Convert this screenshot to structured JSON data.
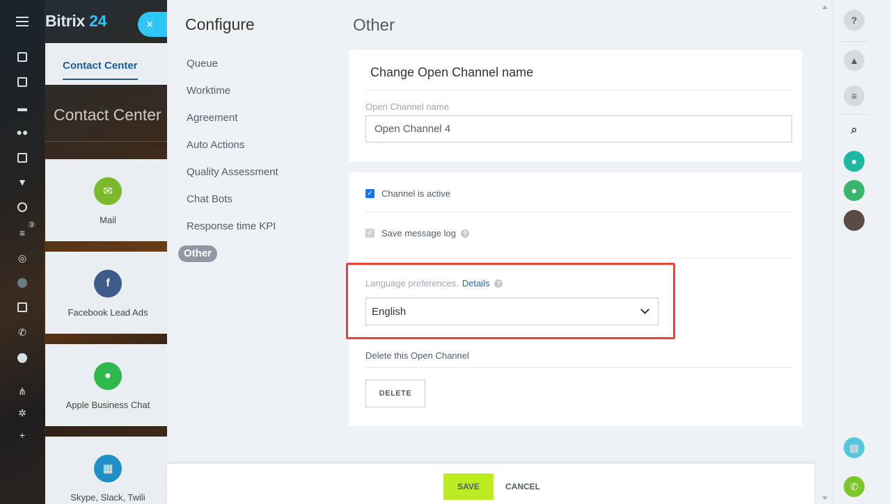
{
  "app": {
    "logo_text": "Bitrix",
    "logo_num": "24",
    "close_icon": "×"
  },
  "background": {
    "tab_label": "Contact Center",
    "page_title": "Contact Center",
    "tiles": [
      {
        "label": "Mail",
        "color": "#7bb82c",
        "icon": "envelope-icon"
      },
      {
        "label": "Facebook Lead Ads",
        "color": "#3e5c8a",
        "icon": "facebook-icon"
      },
      {
        "label": "Apple Business Chat",
        "color": "#2fb84e",
        "icon": "chat-bubble-icon"
      },
      {
        "label": "Skype, Slack, Twili",
        "color": "#1f8fc6",
        "icon": "grid-icon"
      }
    ],
    "nav_badge": "3"
  },
  "slider": {
    "configure_title": "Configure",
    "section_title": "Other",
    "menu": [
      {
        "label": "Queue"
      },
      {
        "label": "Worktime"
      },
      {
        "label": "Agreement"
      },
      {
        "label": "Auto Actions"
      },
      {
        "label": "Quality Assessment"
      },
      {
        "label": "Chat Bots"
      },
      {
        "label": "Response time KPI"
      },
      {
        "label": "Other",
        "active": true
      }
    ]
  },
  "rename_card": {
    "heading": "Change Open Channel name",
    "field_label": "Open Channel name",
    "field_value": "Open Channel 4"
  },
  "settings_card": {
    "channel_active_label": "Channel is active",
    "save_log_label": "Save message log",
    "lang_label": "Language preferences.",
    "lang_details": "Details",
    "lang_value": "English",
    "delete_label": "Delete this Open Channel",
    "delete_button": "DELETE"
  },
  "footer": {
    "save_label": "SAVE",
    "cancel_label": "CANCEL"
  },
  "right_bar": {
    "help": "?"
  },
  "colors": {
    "accent_blue": "#2fc6f6",
    "save_green": "#bbed21",
    "highlight_red": "#e8423f",
    "link_blue": "#2067b0"
  }
}
